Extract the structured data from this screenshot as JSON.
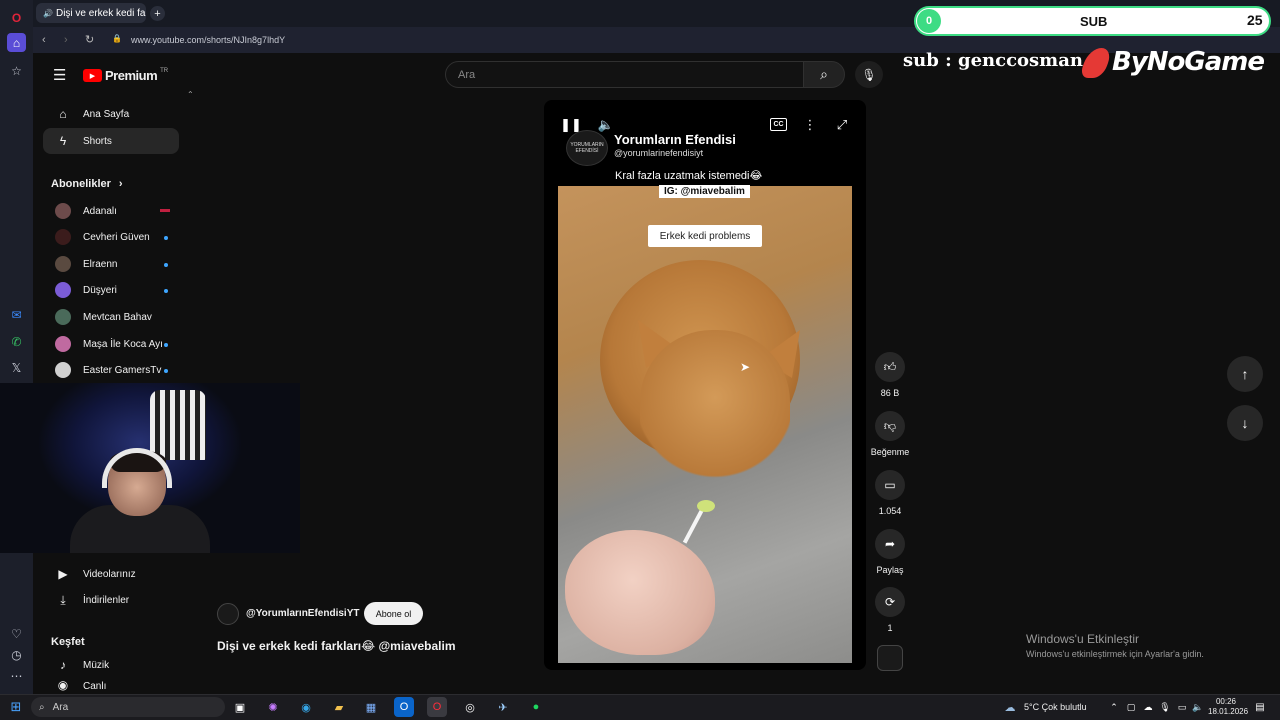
{
  "browser": {
    "tab_title": "Dişi ve erkek kedi farkl",
    "url": "www.youtube.com/shorts/NJIn8g7lhdY"
  },
  "youtube": {
    "logo": "Premium",
    "logo_badge": "TR",
    "search_placeholder": "Ara",
    "nav": {
      "home": "Ana Sayfa",
      "shorts": "Shorts",
      "subscriptions": "Abonelikler",
      "videos": "Videolarınız",
      "downloads": "İndirilenler",
      "explore": "Keşfet",
      "music": "Müzik",
      "live": "Canlı"
    },
    "subscriptions": [
      {
        "name": "Adanalı",
        "color": "#6d4b4b"
      },
      {
        "name": "Cevheri Güven",
        "color": "#3b1c1c"
      },
      {
        "name": "Elraenn",
        "color": "#5a4a40"
      },
      {
        "name": "Düşyeri",
        "color": "#7b5cd6"
      },
      {
        "name": "Mevtcan Bahav",
        "color": "#4a6a5a"
      },
      {
        "name": "Maşa İle Koca Ayı",
        "color": "#c06aa0"
      },
      {
        "name": "Easter GamersTv",
        "color": "#d0d0d0"
      }
    ]
  },
  "short": {
    "channel_name": "Yorumların Efendisi",
    "channel_handle": "@yorumlarinefendisiyt",
    "caption": "Kral fazla uzatmak istemedi😂",
    "ig_tag": "IG: @miavebalim",
    "sticker": "Erkek kedi problems",
    "logo_text": "YORUMLARIN EFENDİSİ",
    "owner": "@YorumlarınEfendisiYT",
    "subscribe": "Abone ol",
    "title": "Dişi ve erkek kedi farkları😂 @miavebalim",
    "actions": {
      "likes": "86 B",
      "dislike": "Beğenme",
      "comments": "1.054",
      "share": "Paylaş",
      "remix": "1"
    }
  },
  "overlay": {
    "sub_current": "0",
    "sub_label": "SUB",
    "sub_goal": "25",
    "promo_text": "sub : genccosman",
    "brand": "ByNoGame"
  },
  "windows": {
    "activate_title": "Windows'u Etkinleştir",
    "activate_sub": "Windows'u etkinleştirmek için Ayarlar'a gidin.",
    "search": "Ara",
    "weather": "5°C  Çok bulutlu",
    "time": "00:26",
    "date": "18.01.2026"
  }
}
